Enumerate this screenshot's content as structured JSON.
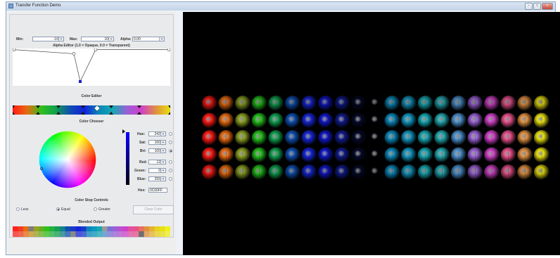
{
  "window": {
    "title": "Transfer Function Demo"
  },
  "range": {
    "min_label": "Min:",
    "min_value": "-10",
    "max_label": "Max:",
    "max_value": "10",
    "alpha_label": "Alpha:",
    "alpha_value": "0.00"
  },
  "alpha_editor": {
    "title": "Alpha Editor  (1.0 = Opaque, 0.0 = Transparent)",
    "stops": [
      0.97,
      0.86,
      0.86,
      0.12,
      0.97,
      0.86,
      0.97
    ]
  },
  "color_editor": {
    "title": "Color Editor"
  },
  "color_chooser": {
    "title": "Color Chooser",
    "hue_label": "Hue:",
    "hue_value": "242",
    "sat_label": "Sat:",
    "sat_value": "100",
    "bri_label": "Bri:",
    "bri_value": "100",
    "red_label": "Red:",
    "red_value": "12",
    "green_label": "Green:",
    "green_value": "0",
    "blue_label": "Blue:",
    "blue_value": "255",
    "hex_label": "Hex:",
    "hex_value": "0C00FF",
    "selected_mode": "bri"
  },
  "stop_controls": {
    "title": "Color Stop Controls",
    "less": "Less",
    "equal": "Equal",
    "greater": "Greater",
    "clear": "Clear Color",
    "selected": "equal"
  },
  "blended": {
    "title": "Blended Output"
  },
  "render": {
    "colors": [
      "#ff1a14",
      "#e86a10",
      "#8aa020",
      "#22c01a",
      "#10a050",
      "#0e4fb0",
      "#1525d6",
      "#1017c8",
      "#101a8a",
      "#060a28",
      "#000006",
      "#0a86b8",
      "#1296c0",
      "#15a8b2",
      "#22a8b0",
      "#4c90cc",
      "#9a60d6",
      "#d040c8",
      "#e8508a",
      "#e09040",
      "#e8e010"
    ],
    "brightness": [
      0.85,
      1.0,
      1.0,
      1.0,
      0.9
    ]
  }
}
